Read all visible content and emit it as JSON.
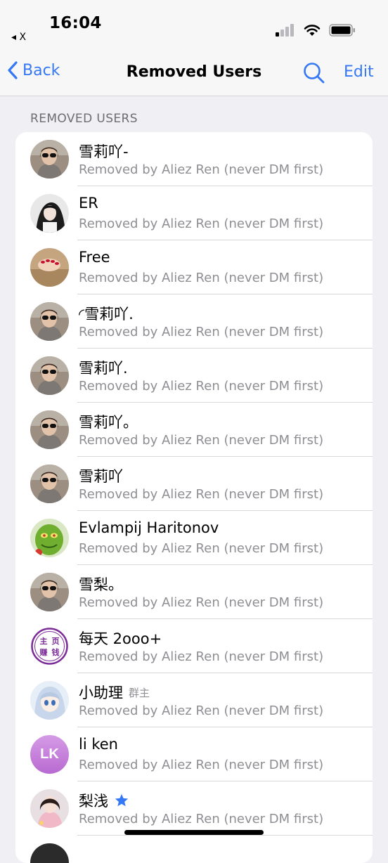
{
  "status_bar": {
    "time": "16:04",
    "back_app": "◂ X"
  },
  "nav": {
    "back_label": "Back",
    "title": "Removed Users",
    "edit_label": "Edit"
  },
  "section": {
    "header": "REMOVED USERS"
  },
  "users": [
    {
      "name": "雪莉吖-",
      "removed_by": "Removed by Aliez Ren (never DM first)",
      "avatar": "photo-woman-sunglasses"
    },
    {
      "name": "ER",
      "removed_by": "Removed by Aliez Ren (never DM first)",
      "avatar": "photo-woman-dark-hair"
    },
    {
      "name": "Free",
      "removed_by": "Removed by Aliez Ren (never DM first)",
      "avatar": "photo-hands-red-nails"
    },
    {
      "name": "◜雪莉吖.",
      "removed_by": "Removed by Aliez Ren (never DM first)",
      "avatar": "photo-woman-sunglasses"
    },
    {
      "name": "雪莉吖.",
      "removed_by": "Removed by Aliez Ren (never DM first)",
      "avatar": "photo-woman-sunglasses"
    },
    {
      "name": "雪莉吖。",
      "removed_by": "Removed by Aliez Ren (never DM first)",
      "avatar": "photo-woman-sunglasses"
    },
    {
      "name": "雪莉吖",
      "removed_by": "Removed by Aliez Ren (never DM first)",
      "avatar": "photo-woman-sunglasses"
    },
    {
      "name": "Evlampij Haritonov",
      "removed_by": "Removed by Aliez Ren (never DM first)",
      "avatar": "photo-green-character"
    },
    {
      "name": "雪梨。",
      "removed_by": "Removed by Aliez Ren (never DM first)",
      "avatar": "photo-woman-sunglasses"
    },
    {
      "name": "每天 2ooo+",
      "removed_by": "Removed by Aliez Ren (never DM first)",
      "avatar": "stamp-badge",
      "avatar_text": [
        "主",
        "页",
        "赚",
        "钱"
      ]
    },
    {
      "name": "小助理",
      "tag": "群主",
      "removed_by": "Removed by Aliez Ren (never DM first)",
      "avatar": "photo-anime-girl"
    },
    {
      "name": "li ken",
      "removed_by": "Removed by Aliez Ren (never DM first)",
      "avatar": "initials",
      "initials": "LK"
    },
    {
      "name": "梨浅",
      "verified_star": true,
      "removed_by": "Removed by Aliez Ren (never DM first)",
      "avatar": "photo-woman-dress"
    }
  ],
  "colors": {
    "accent": "#3478f6",
    "initials_avatar": "#c77ddb",
    "stamp_purple": "#7b2b98"
  }
}
